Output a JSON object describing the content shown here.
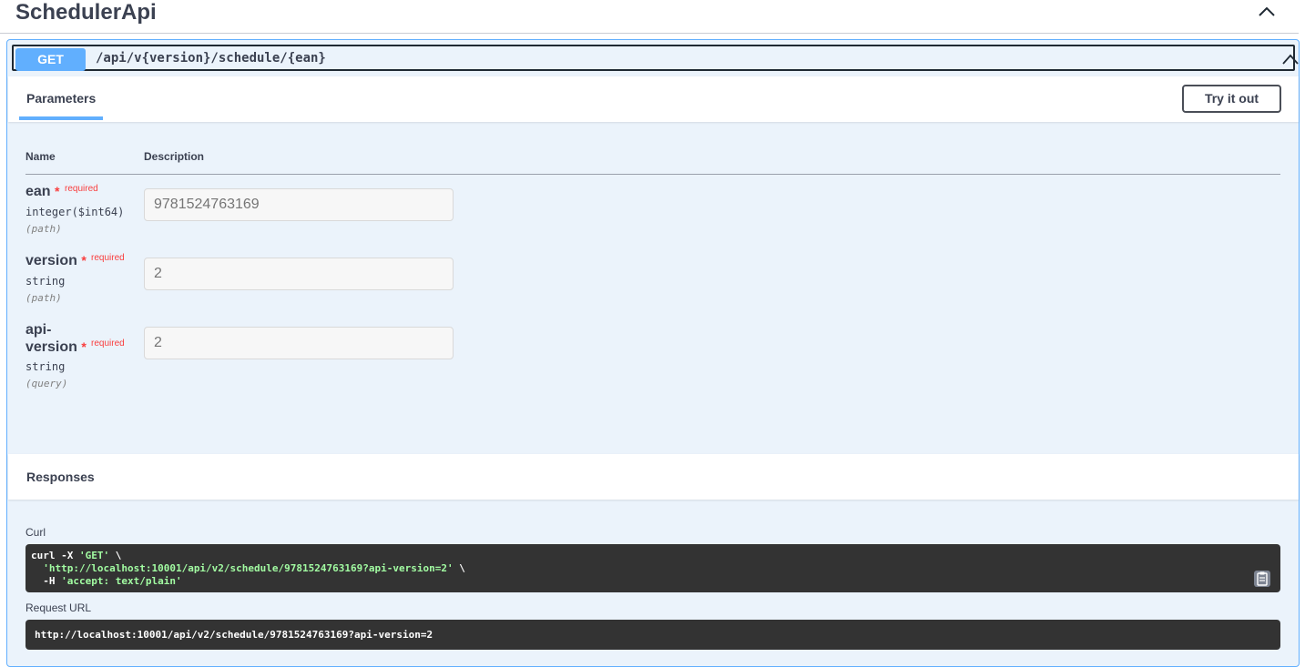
{
  "tag": {
    "title": "SchedulerApi"
  },
  "operation": {
    "method": "GET",
    "path": "/api/v{version}/schedule/{ean}"
  },
  "parameters_section": {
    "tab_label": "Parameters",
    "try_button_label": "Try it out",
    "col_name": "Name",
    "col_description": "Description",
    "items": [
      {
        "name": "ean",
        "star": "*",
        "required_label": "required",
        "type": "integer($int64)",
        "in": "(path)",
        "value": "9781524763169"
      },
      {
        "name": "version",
        "star": "*",
        "required_label": "required",
        "type": "string",
        "in": "(path)",
        "value": "2"
      },
      {
        "name_line1": "api-",
        "name_line2": "version",
        "star": "*",
        "required_label": "required",
        "type": "string",
        "in": "(query)",
        "value": "2"
      }
    ]
  },
  "responses_section": {
    "title": "Responses",
    "curl_label": "Curl",
    "curl": {
      "line1_cmd": "curl -X ",
      "line1_str": "'GET'",
      "line1_end": " \\",
      "line2_indent": "  ",
      "line2_str": "'http://localhost:10001/api/v2/schedule/9781524763169?api-version=2'",
      "line2_end": " \\",
      "line3_cmd": "  -H ",
      "line3_str": "'accept: text/plain'"
    },
    "request_url_label": "Request URL",
    "request_url": "http://localhost:10001/api/v2/schedule/9781524763169?api-version=2"
  },
  "icons": {
    "tag_collapse": "chevron-up-icon",
    "op_collapse": "chevron-up-icon",
    "copy": "clipboard-copy-icon"
  },
  "colors": {
    "get_method": "#61affe",
    "opblock_bg": "#ebf3fb",
    "required": "#f93e3e",
    "code_bg": "#333333",
    "code_string": "#a2fca2"
  }
}
